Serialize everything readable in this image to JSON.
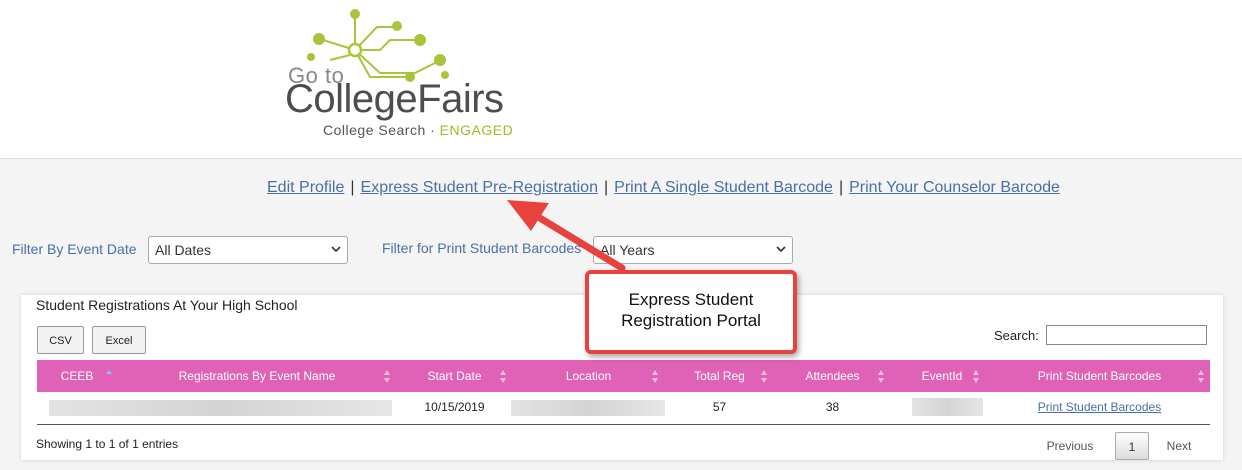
{
  "logo": {
    "goto": "Go to",
    "name": "CollegeFairs",
    "tagline_prefix": "College Search · ",
    "tagline_accent": "ENGAGED"
  },
  "nav": {
    "items": [
      "Edit Profile",
      "Express Student Pre-Registration",
      "Print A Single Student Barcode",
      "Print Your Counselor Barcode"
    ],
    "separator": "|"
  },
  "filters": {
    "event_date_label": "Filter By Event Date",
    "event_date_value": "All Dates",
    "barcodes_label": "Filter for Print Student Barcodes",
    "barcodes_value": "All Years"
  },
  "panel": {
    "title": "Student Registrations At Your High School",
    "csv_label": "CSV",
    "excel_label": "Excel",
    "search_label": "Search:",
    "search_value": ""
  },
  "table": {
    "columns": [
      "CEEB",
      "Registrations By Event Name",
      "Start Date",
      "Location",
      "Total Reg",
      "Attendees",
      "EventId",
      "Print Student Barcodes"
    ],
    "rows": [
      {
        "start_date": "10/15/2019",
        "total_reg": "57",
        "attendees": "38",
        "print_link": "Print Student Barcodes"
      }
    ],
    "info": "Showing 1 to 1 of 1 entries",
    "pagination": {
      "previous": "Previous",
      "current": "1",
      "next": "Next"
    }
  },
  "callout": {
    "line1": "Express Student",
    "line2": "Registration Portal"
  },
  "colors": {
    "header_pink": "#e062b6",
    "link_blue": "#4a6fa5",
    "callout_red": "#e8423f",
    "logo_green": "#9dbb2a"
  }
}
